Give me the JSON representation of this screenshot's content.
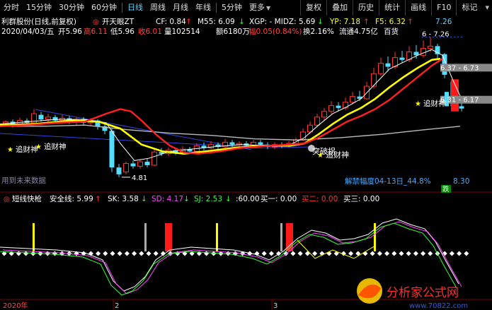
{
  "toolbar": {
    "periods": [
      "分时",
      "15分钟",
      "30分钟",
      "60分钟",
      "日线",
      "周线",
      "月线",
      "年线",
      "5分钟",
      "更多"
    ],
    "active_period": "日线",
    "buttons": [
      "复权",
      "叠加",
      "历史",
      "统计",
      "画线",
      "F10",
      "标记"
    ]
  },
  "main_indicator": {
    "stock_name": "利群股份(日线,前复权)",
    "formula_name": "开天眼ZT",
    "cf_label": "CF: 0.84",
    "m55_label": "M55: 6.09",
    "xgp_label": "XGP: - MIDZ: 5.69",
    "yp_label": "YP: 7.18",
    "f5_label": "F5: 6.32",
    "top_value": "7.26",
    "colors": {
      "cf": "#ffffff",
      "m55": "#ffffff",
      "xgp": "#ffffff",
      "yp": "#ffff00",
      "f5": "#ffff00"
    }
  },
  "quote_line": {
    "date": "2020/04/03/五",
    "open": "开5.96",
    "high": "高6.11",
    "low": "低5.96",
    "close": "收6.01",
    "volume": "量102514",
    "amount": "额6180万",
    "change": "幅0.05(0.84%)",
    "turnover": "换2.16%",
    "float": "流通4.75亿",
    "sector": "百货"
  },
  "price_labels": {
    "high_marker": "6 - 7.26",
    "range_label_1": "6.37 - 6.73",
    "range_label_2": "6.31 - 6.17",
    "low_marker": "4.81",
    "signal_buy": "追财神",
    "signal_break": "突破拐",
    "signal_break_2": "追财神",
    "signal_up": "追财神",
    "future_data": "用到未来数据",
    "release_label": "解禁幅度04-13日_44.8%",
    "release_value": "8.30",
    "fall_label": "跌"
  },
  "sub_indicator": {
    "name": "短线快枪",
    "safe_line": "安全线: 5.99",
    "sk": "SK: 3.58",
    "sd": "SD: 4.17",
    "sj": "SJ: 2.53",
    "x": ":60.00",
    "buy1": "买一: 0.00",
    "buy2": "买二: 0.00",
    "buy3": "买三: 0.00",
    "colors": {
      "sk": "#ffffff",
      "sd": "#ff44ff",
      "sj": "#33ff33",
      "buy2": "#ff3333"
    }
  },
  "x_axis": {
    "labels": [
      "2020年",
      "2",
      "3"
    ]
  },
  "watermark": {
    "text": "分析家公式网",
    "url": "www.70822.com"
  }
}
